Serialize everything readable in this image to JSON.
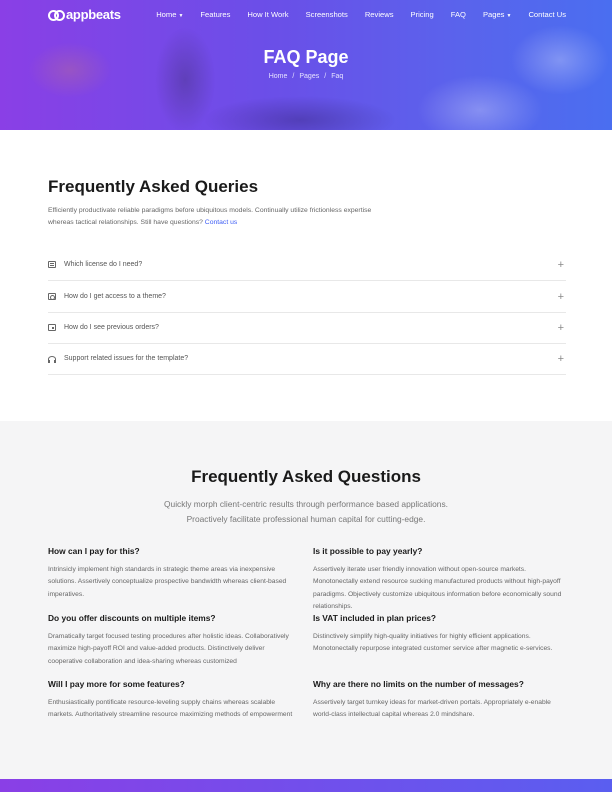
{
  "nav": {
    "logo": "appbeats",
    "items": [
      {
        "label": "Home",
        "dropdown": true
      },
      {
        "label": "Features"
      },
      {
        "label": "How It Work"
      },
      {
        "label": "Screenshots"
      },
      {
        "label": "Reviews"
      },
      {
        "label": "Pricing"
      },
      {
        "label": "FAQ"
      },
      {
        "label": "Pages",
        "dropdown": true
      },
      {
        "label": "Contact Us"
      }
    ]
  },
  "hero": {
    "title": "FAQ Page",
    "breadcrumbs": [
      "Home",
      "Pages",
      "Faq"
    ],
    "separator": "/"
  },
  "queries": {
    "title": "Frequently Asked Queries",
    "intro": "Efficiently productivate reliable paradigms before ubiquitous models. Continually utilize frictionless expertise whereas tactical relationships. Still have questions?",
    "contact_link": "Contact us",
    "items": [
      {
        "label": "Which license do I need?",
        "icon": "document-icon"
      },
      {
        "label": "How do I get access to a theme?",
        "icon": "access-icon"
      },
      {
        "label": "How do I see previous orders?",
        "icon": "orders-icon"
      },
      {
        "label": "Support related issues for the template?",
        "icon": "headset-icon"
      }
    ],
    "expand_symbol": "+"
  },
  "faq": {
    "title": "Frequently Asked Questions",
    "subtitle_line1": "Quickly morph client-centric results through performance based applications.",
    "subtitle_line2": "Proactively facilitate professional human capital for cutting-edge.",
    "items": [
      {
        "question": "How can I pay for this?",
        "answer": "Intrinsicly implement high standards in strategic theme areas via inexpensive solutions. Assertively conceptualize prospective bandwidth whereas client-based imperatives."
      },
      {
        "question": "Is it possible to pay yearly?",
        "answer": "Assertively iterate user friendly innovation without open-source markets. Monotonectally extend resource sucking manufactured products without high-payoff paradigms. Objectively customize ubiquitous information before economically sound relationships."
      },
      {
        "question": "Do you offer discounts on multiple items?",
        "answer": "Dramatically target focused testing procedures after holistic ideas. Collaboratively maximize high-payoff ROI and value-added products. Distinctively deliver cooperative collaboration and idea-sharing whereas customized"
      },
      {
        "question": "Is VAT included in plan prices?",
        "answer": "Distinctively simplify high-quality initiatives for highly efficient applications. Monotonectally repurpose integrated customer service after magnetic e-services."
      },
      {
        "question": "Will I pay more for some features?",
        "answer": "Enthusiastically pontificate resource-leveling supply chains whereas scalable markets. Authoritatively streamline resource maximizing methods of empowerment"
      },
      {
        "question": "Why are there no limits on the number of messages?",
        "answer": "Assertively target turnkey ideas for market-driven portals. Appropriately e-enable world-class intellectual capital whereas 2.0 mindshare."
      }
    ]
  },
  "colors": {
    "accent": "#3d5df5",
    "gradient_start": "#8a3fe6",
    "gradient_end": "#4a6ef0"
  }
}
